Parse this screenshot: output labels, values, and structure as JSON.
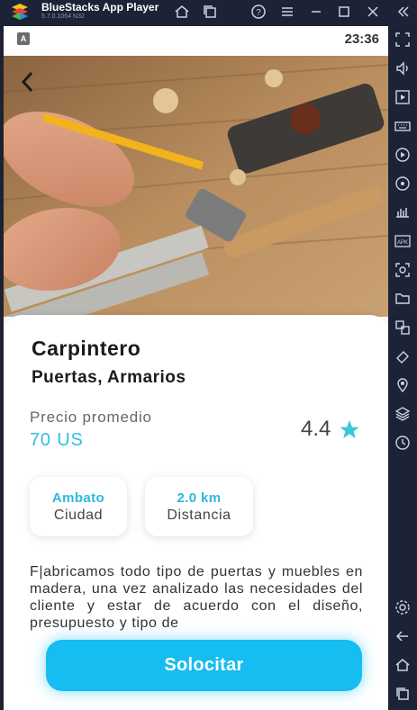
{
  "window": {
    "title": "BlueStacks App Player",
    "version": "5.7.0.1064  N32"
  },
  "status": {
    "badge": "A",
    "time": "23:36"
  },
  "service": {
    "title": "Carpintero",
    "subtitle": "Puertas, Armarios",
    "price_label": "Precio promedio",
    "price_value": "70 US",
    "rating": "4.4",
    "city_value": "Ambato",
    "city_label": "Ciudad",
    "distance_value": "2.0 km",
    "distance_label": "Distancia",
    "description": "F|abricamos todo tipo de puertas y muebles en madera, una vez analizado las necesidades del cliente y estar de acuerdo con el diseño, presupuesto y tipo de"
  },
  "action": {
    "label": "Solocitar"
  },
  "colors": {
    "accent": "#16bdf0",
    "teal": "#2fc1e0",
    "star": "#3cc6d8",
    "chrome": "#1d2336"
  }
}
